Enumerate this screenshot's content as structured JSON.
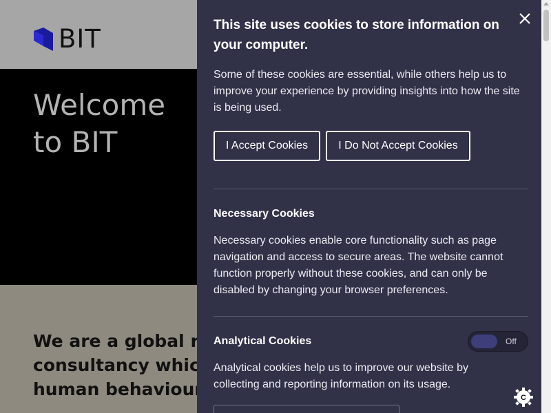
{
  "site": {
    "logo_text": "BIT",
    "hero_title": "Welcome\nto BIT",
    "intro_text": "We are a global research and innovation consultancy which uses deep understanding of human behaviour"
  },
  "cookie_panel": {
    "title": "This site uses cookies to store information on your computer.",
    "intro": "Some of these cookies are essential, while others help us to improve your experience by providing insights into how the site is being used.",
    "accept_label": "I Accept Cookies",
    "decline_label": "I Do Not Accept Cookies",
    "close_icon": "close-icon",
    "sections": [
      {
        "title": "Necessary Cookies",
        "description": "Necessary cookies enable core functionality such as page navigation and access to secure areas. The website cannot function properly without these cookies, and can only be disabled by changing your browser preferences."
      },
      {
        "title": "Analytical Cookies",
        "description": "Analytical cookies help us to improve our website by collecting and reporting information on its usage.",
        "toggle_label": "Off"
      }
    ]
  },
  "colors": {
    "panel_bg": "#313148",
    "hero_bg": "#000000",
    "header_bg": "#a6a6a6",
    "logo_blue": "#1b1bb0"
  },
  "cookie_fab_icon": "cookie-settings-icon"
}
